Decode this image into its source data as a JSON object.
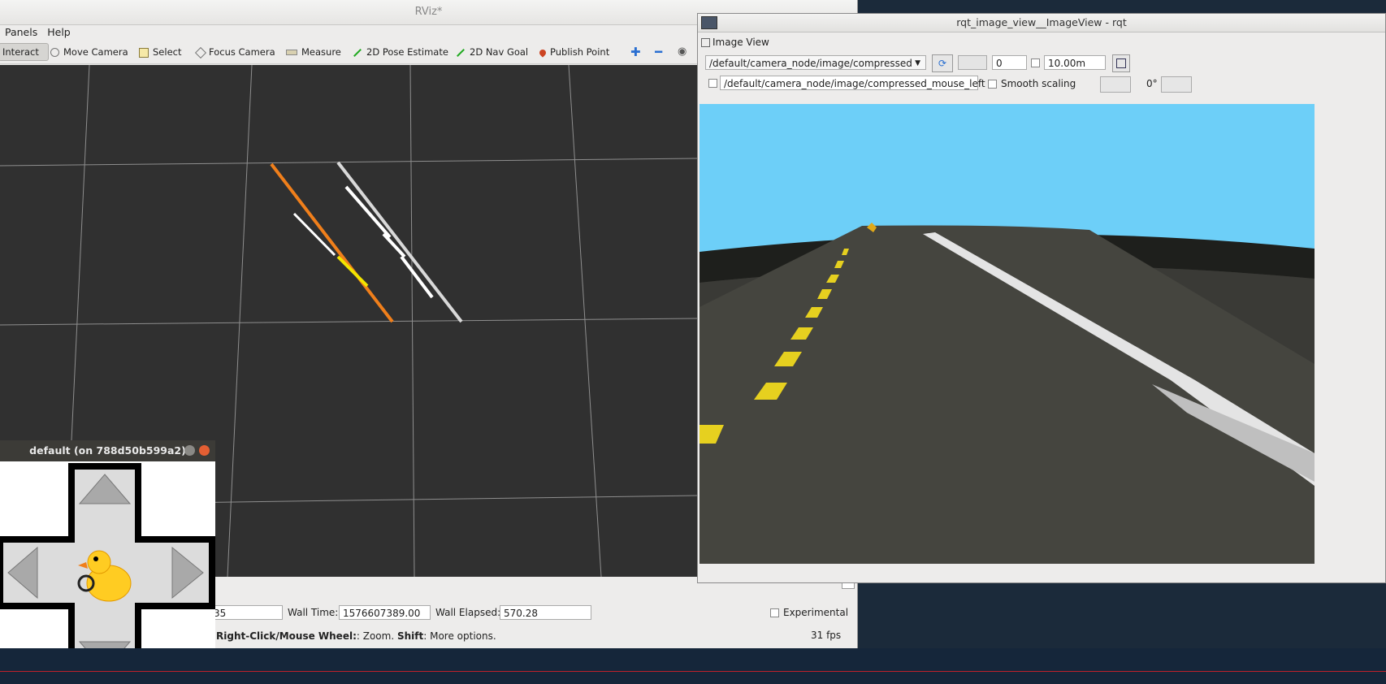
{
  "rviz": {
    "title": "RViz*",
    "menu": [
      "Panels",
      "Help"
    ],
    "tools": {
      "interact": "Interact",
      "move_camera": "Move Camera",
      "select": "Select",
      "focus_camera": "Focus Camera",
      "measure": "Measure",
      "pose_estimate": "2D Pose Estimate",
      "nav_goal": "2D Nav Goal",
      "publish_point": "Publish Point"
    },
    "status": {
      "ros_elapsed_partial": "35",
      "wall_time_label": "Wall Time:",
      "wall_time": "1576607389.00",
      "wall_elapsed_label": "Wall Elapsed:",
      "wall_elapsed": "570.28",
      "experimental_label": "Experimental",
      "hint_bold1": "Right-Click/Mouse Wheel:",
      "hint_text1": ": Zoom. ",
      "hint_bold2": "Shift",
      "hint_text2": ": More options.",
      "fps": "31 fps"
    }
  },
  "rqt": {
    "title": "rqt_image_view__ImageView - rqt",
    "plugin_label": "Image View",
    "topic": "/default/camera_node/image/compressed",
    "spin_value": "0",
    "max_range": "10.00m",
    "mouse_topic": "/default/camera_node/image/compressed_mouse_left",
    "smooth_scaling_label": "Smooth scaling",
    "rotation": "0°"
  },
  "joystick": {
    "title": "default (on 788d50b599a2)"
  }
}
